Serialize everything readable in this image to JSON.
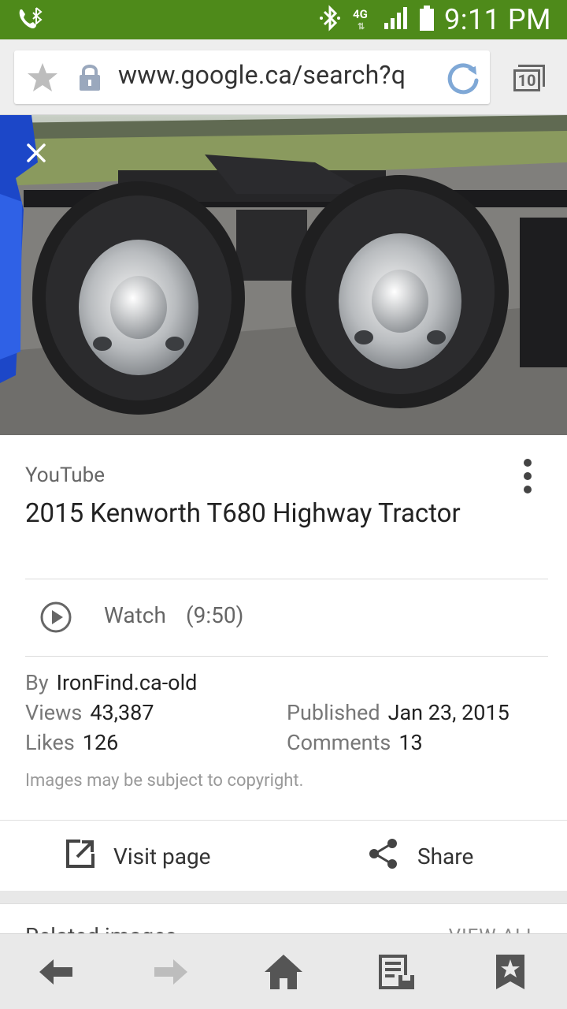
{
  "status_bar": {
    "time": "9:11 PM",
    "network": "4G"
  },
  "browser": {
    "url": "www.google.ca/search?q",
    "tab_count": "10"
  },
  "result": {
    "source": "YouTube",
    "title": "2015 Kenworth T680 Highway Tractor",
    "watch_label": "Watch",
    "duration": "(9:50)",
    "by_label": "By",
    "by_value": "IronFind.ca-old",
    "views_label": "Views",
    "views_value": "43,387",
    "published_label": "Published",
    "published_value": "Jan 23, 2015",
    "likes_label": "Likes",
    "likes_value": "126",
    "comments_label": "Comments",
    "comments_value": "13",
    "copyright": "Images may be subject to copyright.",
    "visit_label": "Visit page",
    "share_label": "Share"
  },
  "related": {
    "title": "Related images",
    "view_all": "VIEW ALL"
  },
  "colors": {
    "status_bar": "#4e8a1a",
    "accent": "#7fa8d6"
  }
}
